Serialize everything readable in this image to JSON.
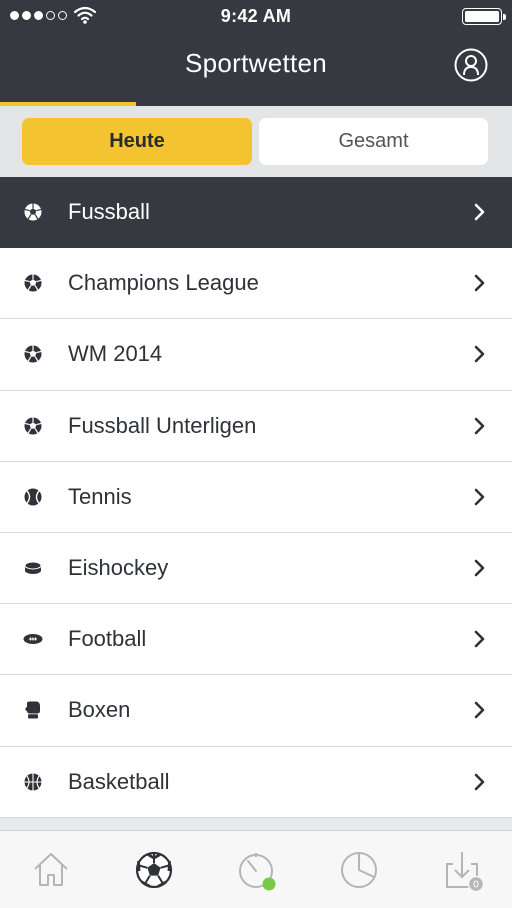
{
  "status_bar": {
    "time": "9:42 AM"
  },
  "header": {
    "title": "Sportwetten",
    "progress_fraction": 0.266
  },
  "segments": {
    "active": "Heute",
    "inactive": "Gesamt"
  },
  "list": [
    {
      "label": "Fussball",
      "icon": "soccer-ball-icon",
      "selected": true
    },
    {
      "label": "Champions League",
      "icon": "soccer-ball-icon"
    },
    {
      "label": "WM 2014",
      "icon": "soccer-ball-icon"
    },
    {
      "label": "Fussball Unterligen",
      "icon": "soccer-ball-icon"
    },
    {
      "label": "Tennis",
      "icon": "tennis-ball-icon"
    },
    {
      "label": "Eishockey",
      "icon": "hockey-puck-icon"
    },
    {
      "label": "Football",
      "icon": "american-football-icon"
    },
    {
      "label": "Boxen",
      "icon": "boxing-glove-icon"
    },
    {
      "label": "Basketball",
      "icon": "basketball-icon"
    }
  ],
  "tabbar": {
    "tabs": [
      "home-icon",
      "soccer-ball-icon",
      "live-timer-icon",
      "pie-chart-icon",
      "download-tray-icon"
    ],
    "download_count": "0"
  },
  "colors": {
    "accent": "#f4c430",
    "header": "#363940",
    "live_dot": "#7ac943"
  }
}
